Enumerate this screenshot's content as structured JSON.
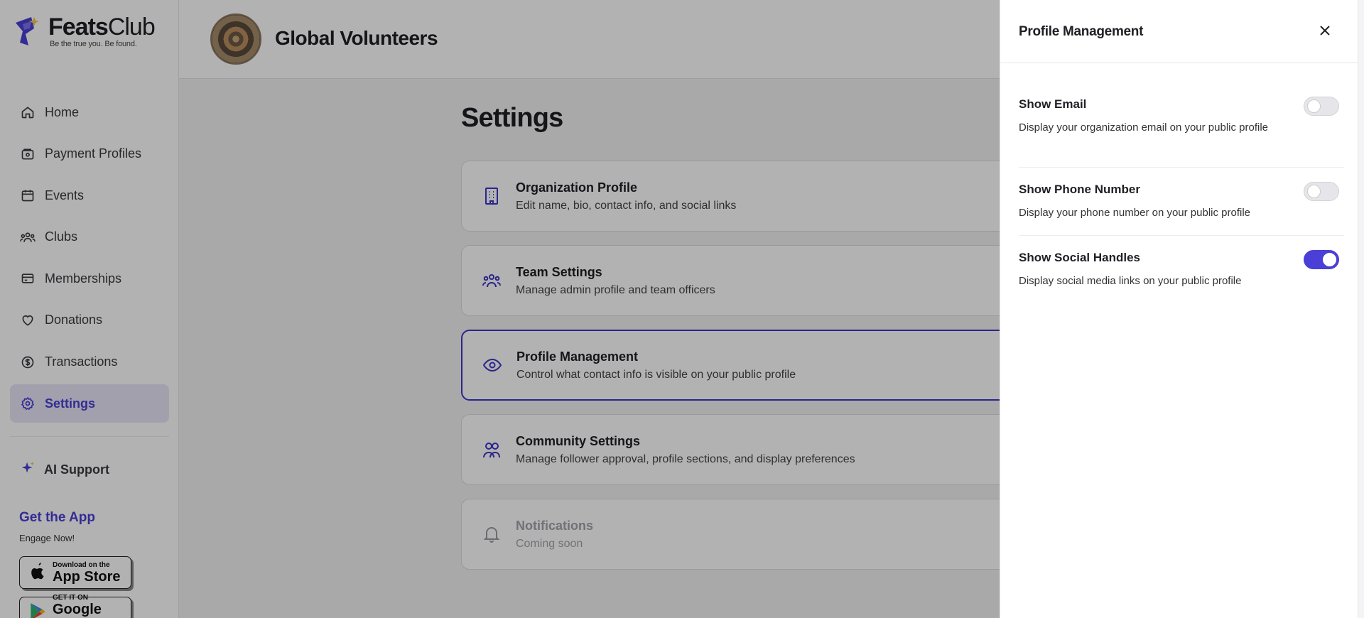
{
  "brand": {
    "name_bold": "Feats",
    "name_light": "Club",
    "tagline": "Be the true you. Be found.",
    "accent": "#4a3fd6"
  },
  "sidebar": {
    "items": [
      {
        "label": "Home",
        "icon": "home-icon"
      },
      {
        "label": "Payment Profiles",
        "icon": "wallet-icon"
      },
      {
        "label": "Events",
        "icon": "calendar-icon"
      },
      {
        "label": "Clubs",
        "icon": "users-icon"
      },
      {
        "label": "Memberships",
        "icon": "card-icon"
      },
      {
        "label": "Donations",
        "icon": "heart-icon"
      },
      {
        "label": "Transactions",
        "icon": "dollar-icon"
      },
      {
        "label": "Settings",
        "icon": "gear-icon",
        "active": true
      }
    ],
    "ai_support": "AI Support",
    "get_app": "Get the App",
    "engage": "Engage Now!",
    "app_store": {
      "small": "Download on the",
      "big": "App Store"
    },
    "google_play": {
      "small": "GET IT ON",
      "big": "Google Play"
    }
  },
  "header": {
    "org_name": "Global Volunteers"
  },
  "main": {
    "title": "Settings",
    "cards": [
      {
        "title": "Organization Profile",
        "desc": "Edit name, bio, contact info, and social links",
        "icon": "building-icon"
      },
      {
        "title": "Team Settings",
        "desc": "Manage admin profile and team officers",
        "icon": "team-icon"
      },
      {
        "title": "Profile Management",
        "desc": "Control what contact info is visible on your public profile",
        "icon": "eye-icon",
        "active": true
      },
      {
        "title": "Community Settings",
        "desc": "Manage follower approval, profile sections, and display preferences",
        "icon": "community-icon"
      },
      {
        "title": "Notifications",
        "desc": "Coming soon",
        "icon": "bell-icon",
        "disabled": true
      }
    ]
  },
  "drawer": {
    "title": "Profile Management",
    "settings": [
      {
        "title": "Show Email",
        "desc": "Display your organization email on your public profile",
        "enabled": false
      },
      {
        "title": "Show Phone Number",
        "desc": "Display your phone number on your public profile",
        "enabled": false
      },
      {
        "title": "Show Social Handles",
        "desc": "Display social media links on your public profile",
        "enabled": true
      }
    ]
  }
}
